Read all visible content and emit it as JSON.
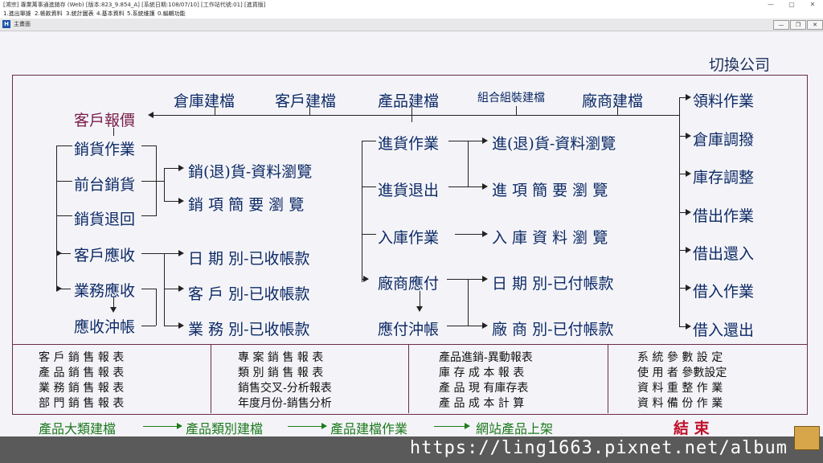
{
  "window": {
    "title": "[鴻宗] 專業萬事通進銷存 (Web) [版本:823_9.854_A] [系統日期:108/07/10] [工作站代號:01] [進貨版]",
    "min_glyph": "—",
    "max_glyph": "▢",
    "close_glyph": "✕"
  },
  "menu": [
    "1.進出單據",
    "2.帳款資料",
    "3.統計圖表",
    "4.基本資料",
    "5.系統維護",
    "0.編輯功能"
  ],
  "subwindow": {
    "icon": "H",
    "label": "主畫面",
    "min": "—",
    "restore": "❐",
    "close": "✕"
  },
  "switch_company": "切換公司",
  "top_row": [
    "倉庫建檔",
    "客戶建檔",
    "產品建檔",
    "組合組裝建檔",
    "廠商建檔"
  ],
  "sales": {
    "quote": "客戶報價",
    "items": [
      "銷貨作業",
      "前台銷貨",
      "銷貨退回",
      "客戶應收",
      "業務應收",
      "應收沖帳"
    ],
    "browse": [
      "銷(退)貨-資料瀏覽",
      "銷 項 簡 要 瀏 覽"
    ],
    "received": [
      "日 期 別-已收帳款",
      "客 戶 別-已收帳款",
      "業 務 別-已收帳款"
    ]
  },
  "purchase": {
    "items": [
      "進貨作業",
      "進貨退出",
      "入庫作業",
      "廠商應付",
      "應付沖帳"
    ],
    "browse": [
      "進(退)貨-資料瀏覽",
      "進 項 簡 要 瀏 覽",
      "入 庫 資 料 瀏 覽"
    ],
    "paid": [
      "日 期 別-已付帳款",
      "廠 商 別-已付帳款"
    ]
  },
  "inventory": [
    "領料作業",
    "倉庫調撥",
    "庫存調整",
    "借出作業",
    "借出還入",
    "借入作業",
    "借入還出"
  ],
  "reports": [
    [
      "客 戶 銷 售 報 表",
      "產 品 銷 售 報 表",
      "業 務 銷 售 報 表",
      "部 門 銷 售 報 表"
    ],
    [
      "專 案 銷 售 報 表",
      "類 別 銷 售 報 表",
      "銷售交叉-分析報表",
      "年度月份-銷售分析"
    ],
    [
      "產品進銷-異動報表",
      "庫 存 成 本 報 表",
      "產 品 現 有庫存表",
      "產 品 成 本 計 算"
    ],
    [
      "系 統 參 數 設 定",
      "使 用 者 參數設定",
      "資 料 重 整 作 業",
      "資 料 備 份 作 業"
    ]
  ],
  "flow": [
    "產品大類建檔",
    "產品類別建檔",
    "產品建檔作業",
    "網站產品上架"
  ],
  "exit": "結 束",
  "watermark": "https://ling1663.pixnet.net/album",
  "colors": {
    "nav_text": "#0d2a66",
    "quote_text": "#7a1d4a",
    "flow_text": "#1e7a1e",
    "exit_text": "#c0102a",
    "frame": "#6b2a4a"
  }
}
